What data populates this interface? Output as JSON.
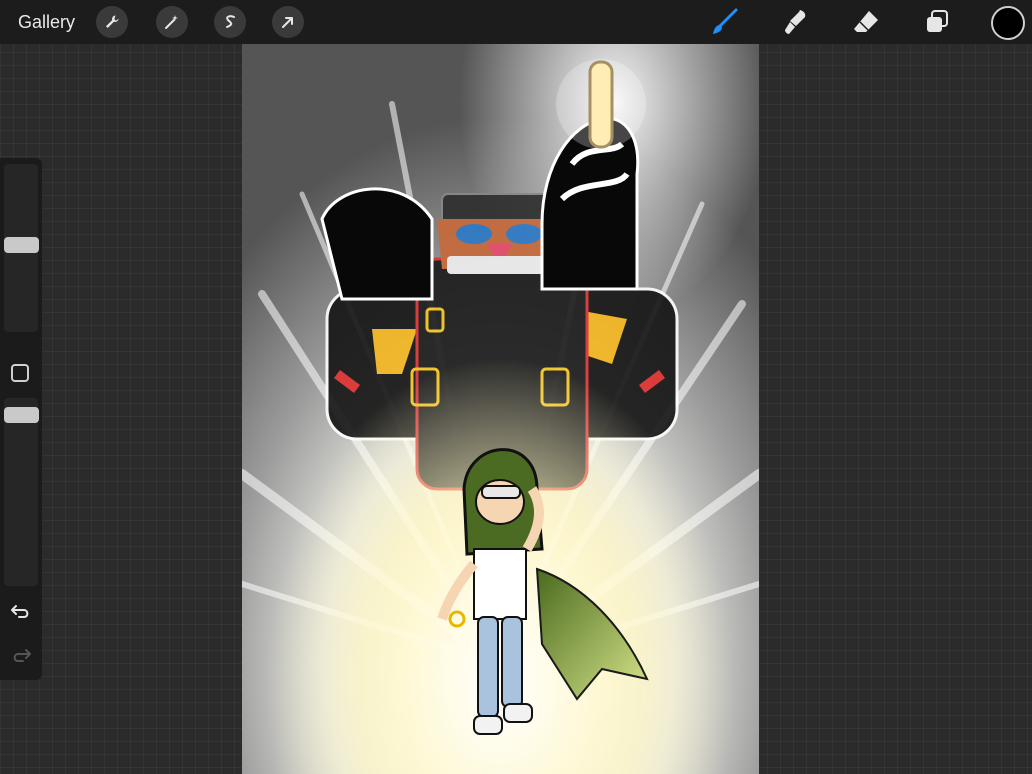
{
  "toolbar": {
    "gallery_label": "Gallery",
    "left_tools": [
      {
        "name": "actions",
        "icon": "wrench-icon"
      },
      {
        "name": "adjustments",
        "icon": "magic-wand-icon"
      },
      {
        "name": "selection",
        "icon": "selection-s-icon"
      },
      {
        "name": "transform",
        "icon": "arrow-cursor-icon"
      }
    ],
    "right_tools": [
      {
        "name": "brush",
        "icon": "brush-icon",
        "active": true,
        "color": "#1e8fff"
      },
      {
        "name": "smudge",
        "icon": "smudge-icon",
        "active": false
      },
      {
        "name": "eraser",
        "icon": "eraser-icon",
        "active": false
      },
      {
        "name": "layers",
        "icon": "layers-icon",
        "active": false
      }
    ],
    "current_color": "#000000"
  },
  "sidebar": {
    "brush_size_level": 0.52,
    "opacity_level": 0.95,
    "modify_icon": "square-modify-icon",
    "undo_icon": "undo-icon",
    "redo_icon": "redo-icon"
  },
  "canvas": {
    "artwork": "illustration"
  }
}
